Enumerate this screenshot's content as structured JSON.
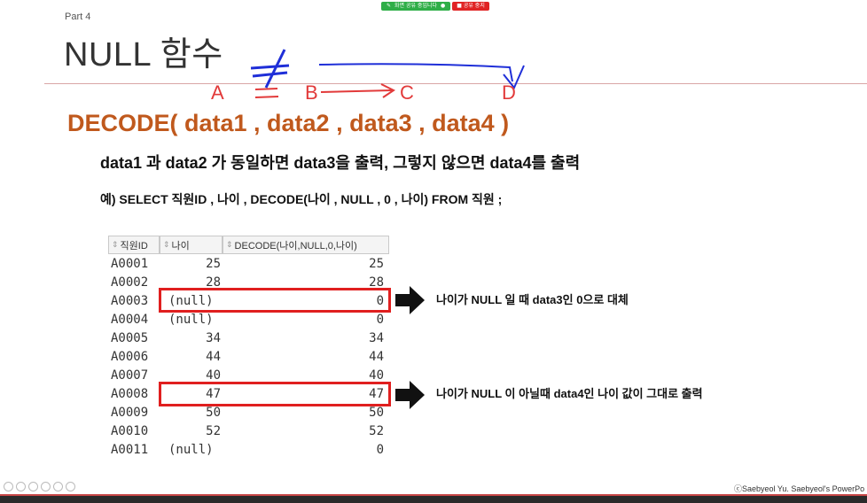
{
  "share_bar": {
    "sharing_label": "화면 공유 중입니다",
    "stop_label": "공유 중지"
  },
  "slide": {
    "part_label": "Part 4",
    "title": "NULL 함수",
    "annotation": {
      "a": "A",
      "b": "B",
      "c": "C",
      "d": "D"
    },
    "decode_heading": "DECODE( data1 , data2 , data3 , data4 )",
    "description": "data1 과 data2 가 동일하면 data3을 출력, 그렇지 않으면 data4를 출력",
    "example": "예) SELECT 직원ID , 나이 , DECODE(나이 , NULL , 0 , 나이) FROM 직원 ;",
    "note_null": "나이가 NULL 일 때 data3인 0으로 대체",
    "note_notnull": "나이가 NULL 이 아닐때 data4인 나이 값이 그대로 출력",
    "footer": "ⓒSaebyeol Yu. Saebyeol's PowerPo"
  },
  "grid": {
    "columns": [
      "직원ID",
      "나이",
      "DECODE(나이,NULL,0,나이)"
    ],
    "rows": [
      {
        "id": "A0001",
        "age": "25",
        "decode": "25"
      },
      {
        "id": "A0002",
        "age": "28",
        "decode": "28"
      },
      {
        "id": "A0003",
        "age": "(null)",
        "decode": "0"
      },
      {
        "id": "A0004",
        "age": "(null)",
        "decode": "0"
      },
      {
        "id": "A0005",
        "age": "34",
        "decode": "34"
      },
      {
        "id": "A0006",
        "age": "44",
        "decode": "44"
      },
      {
        "id": "A0007",
        "age": "40",
        "decode": "40"
      },
      {
        "id": "A0008",
        "age": "47",
        "decode": "47"
      },
      {
        "id": "A0009",
        "age": "50",
        "decode": "50"
      },
      {
        "id": "A0010",
        "age": "52",
        "decode": "52"
      },
      {
        "id": "A0011",
        "age": "(null)",
        "decode": "0"
      }
    ]
  },
  "colors": {
    "heading": "#c0591d",
    "highlight": "#e01f1f",
    "pen_red": "#e23a3a",
    "pen_blue": "#1f2fd8"
  }
}
